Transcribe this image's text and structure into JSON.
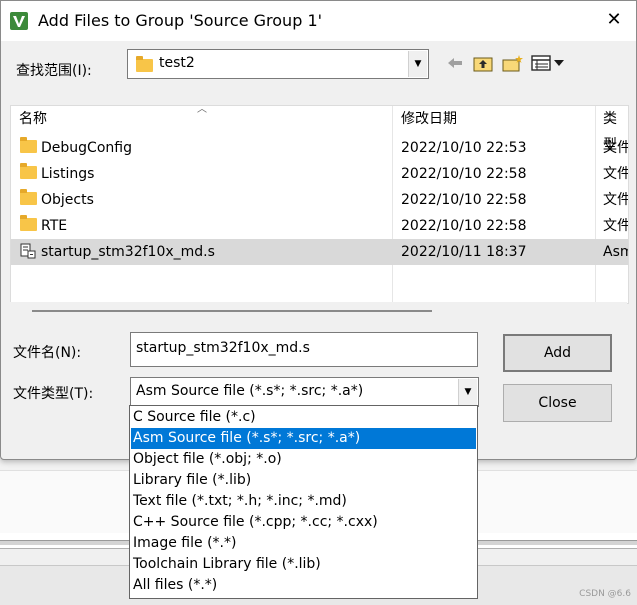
{
  "dialog": {
    "title": "Add Files to Group 'Source Group 1'",
    "look_in_label": "查找范围(I):",
    "look_in_value": "test2",
    "toolbar_icons": [
      "back-arrow-icon",
      "up-folder-icon",
      "new-folder-icon",
      "view-menu-icon"
    ]
  },
  "list": {
    "columns": [
      "名称",
      "修改日期",
      "类型"
    ],
    "rows": [
      {
        "name": "DebugConfig",
        "date": "2022/10/10 22:53",
        "type": "文件夹",
        "icon": "folder-icon"
      },
      {
        "name": "Listings",
        "date": "2022/10/10 22:58",
        "type": "文件夹",
        "icon": "folder-icon"
      },
      {
        "name": "Objects",
        "date": "2022/10/10 22:58",
        "type": "文件夹",
        "icon": "folder-icon"
      },
      {
        "name": "RTE",
        "date": "2022/10/10 22:58",
        "type": "文件夹",
        "icon": "folder-icon"
      },
      {
        "name": "startup_stm32f10x_md.s",
        "date": "2022/10/11 18:37",
        "type": "Asm",
        "icon": "asm-file-icon",
        "selected": true
      }
    ]
  },
  "form": {
    "filename_label": "文件名(N):",
    "filename_value": "startup_stm32f10x_md.s",
    "filetype_label": "文件类型(T):",
    "filetype_value": "Asm Source file (*.s*; *.src; *.a*)"
  },
  "buttons": {
    "add": "Add",
    "close": "Close"
  },
  "dropdown": {
    "options": [
      "C Source file (*.c)",
      "Asm Source file (*.s*; *.src; *.a*)",
      "Object file (*.obj; *.o)",
      "Library file (*.lib)",
      "Text file (*.txt; *.h; *.inc; *.md)",
      "C++ Source file (*.cpp; *.cc; *.cxx)",
      "Image file (*.*)",
      "Toolchain Library file (*.lib)",
      "All files (*.*)"
    ],
    "selected_index": 1
  },
  "watermark": "CSDN @6.6",
  "colors": {
    "selection_blue": "#0078d7",
    "folder_yellow": "#f8c548",
    "row_selected": "#d9d9d9"
  }
}
